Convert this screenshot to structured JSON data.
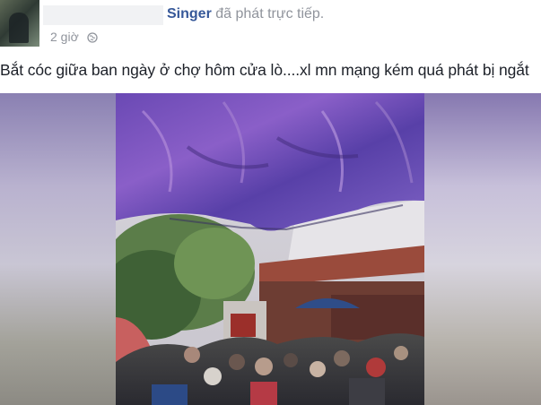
{
  "post": {
    "author": "Singer",
    "action": "đã phát trực tiếp.",
    "time": "2 giờ",
    "caption": "Bắt cóc giữa ban ngày ở chợ hôm cửa lò....xl mn mạng kém quá phát bị ngắt"
  },
  "icons": {
    "privacy": "globe-icon"
  },
  "colors": {
    "author_link": "#365899",
    "meta_text": "#90949c",
    "caption_text": "#1d2129"
  }
}
